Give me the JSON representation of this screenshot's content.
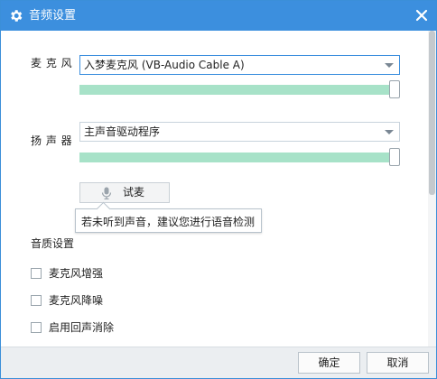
{
  "window": {
    "title": "音频设置",
    "accent_color": "#3c8fde",
    "title_icon": "gear-icon",
    "close_icon": "close-icon"
  },
  "microphone": {
    "label": "麦 克 风",
    "selected": "入梦麦克风 (VB-Audio Cable A)",
    "volume_fraction": 1.0
  },
  "speaker": {
    "label": "扬 声 器",
    "selected": "主声音驱动程序",
    "volume_fraction": 1.0
  },
  "slider_color": "#a7e2c8",
  "test_mic": {
    "label": "试麦",
    "icon": "microphone-icon"
  },
  "tooltip": {
    "text": "若未听到声音，建议您进行语音检测"
  },
  "quality": {
    "title": "音质设置",
    "options": [
      {
        "label": "麦克风增强",
        "checked": false
      },
      {
        "label": "麦克风降噪",
        "checked": false
      },
      {
        "label": "启用回声消除",
        "checked": false
      }
    ]
  },
  "footer": {
    "ok_label": "确定",
    "cancel_label": "取消"
  }
}
